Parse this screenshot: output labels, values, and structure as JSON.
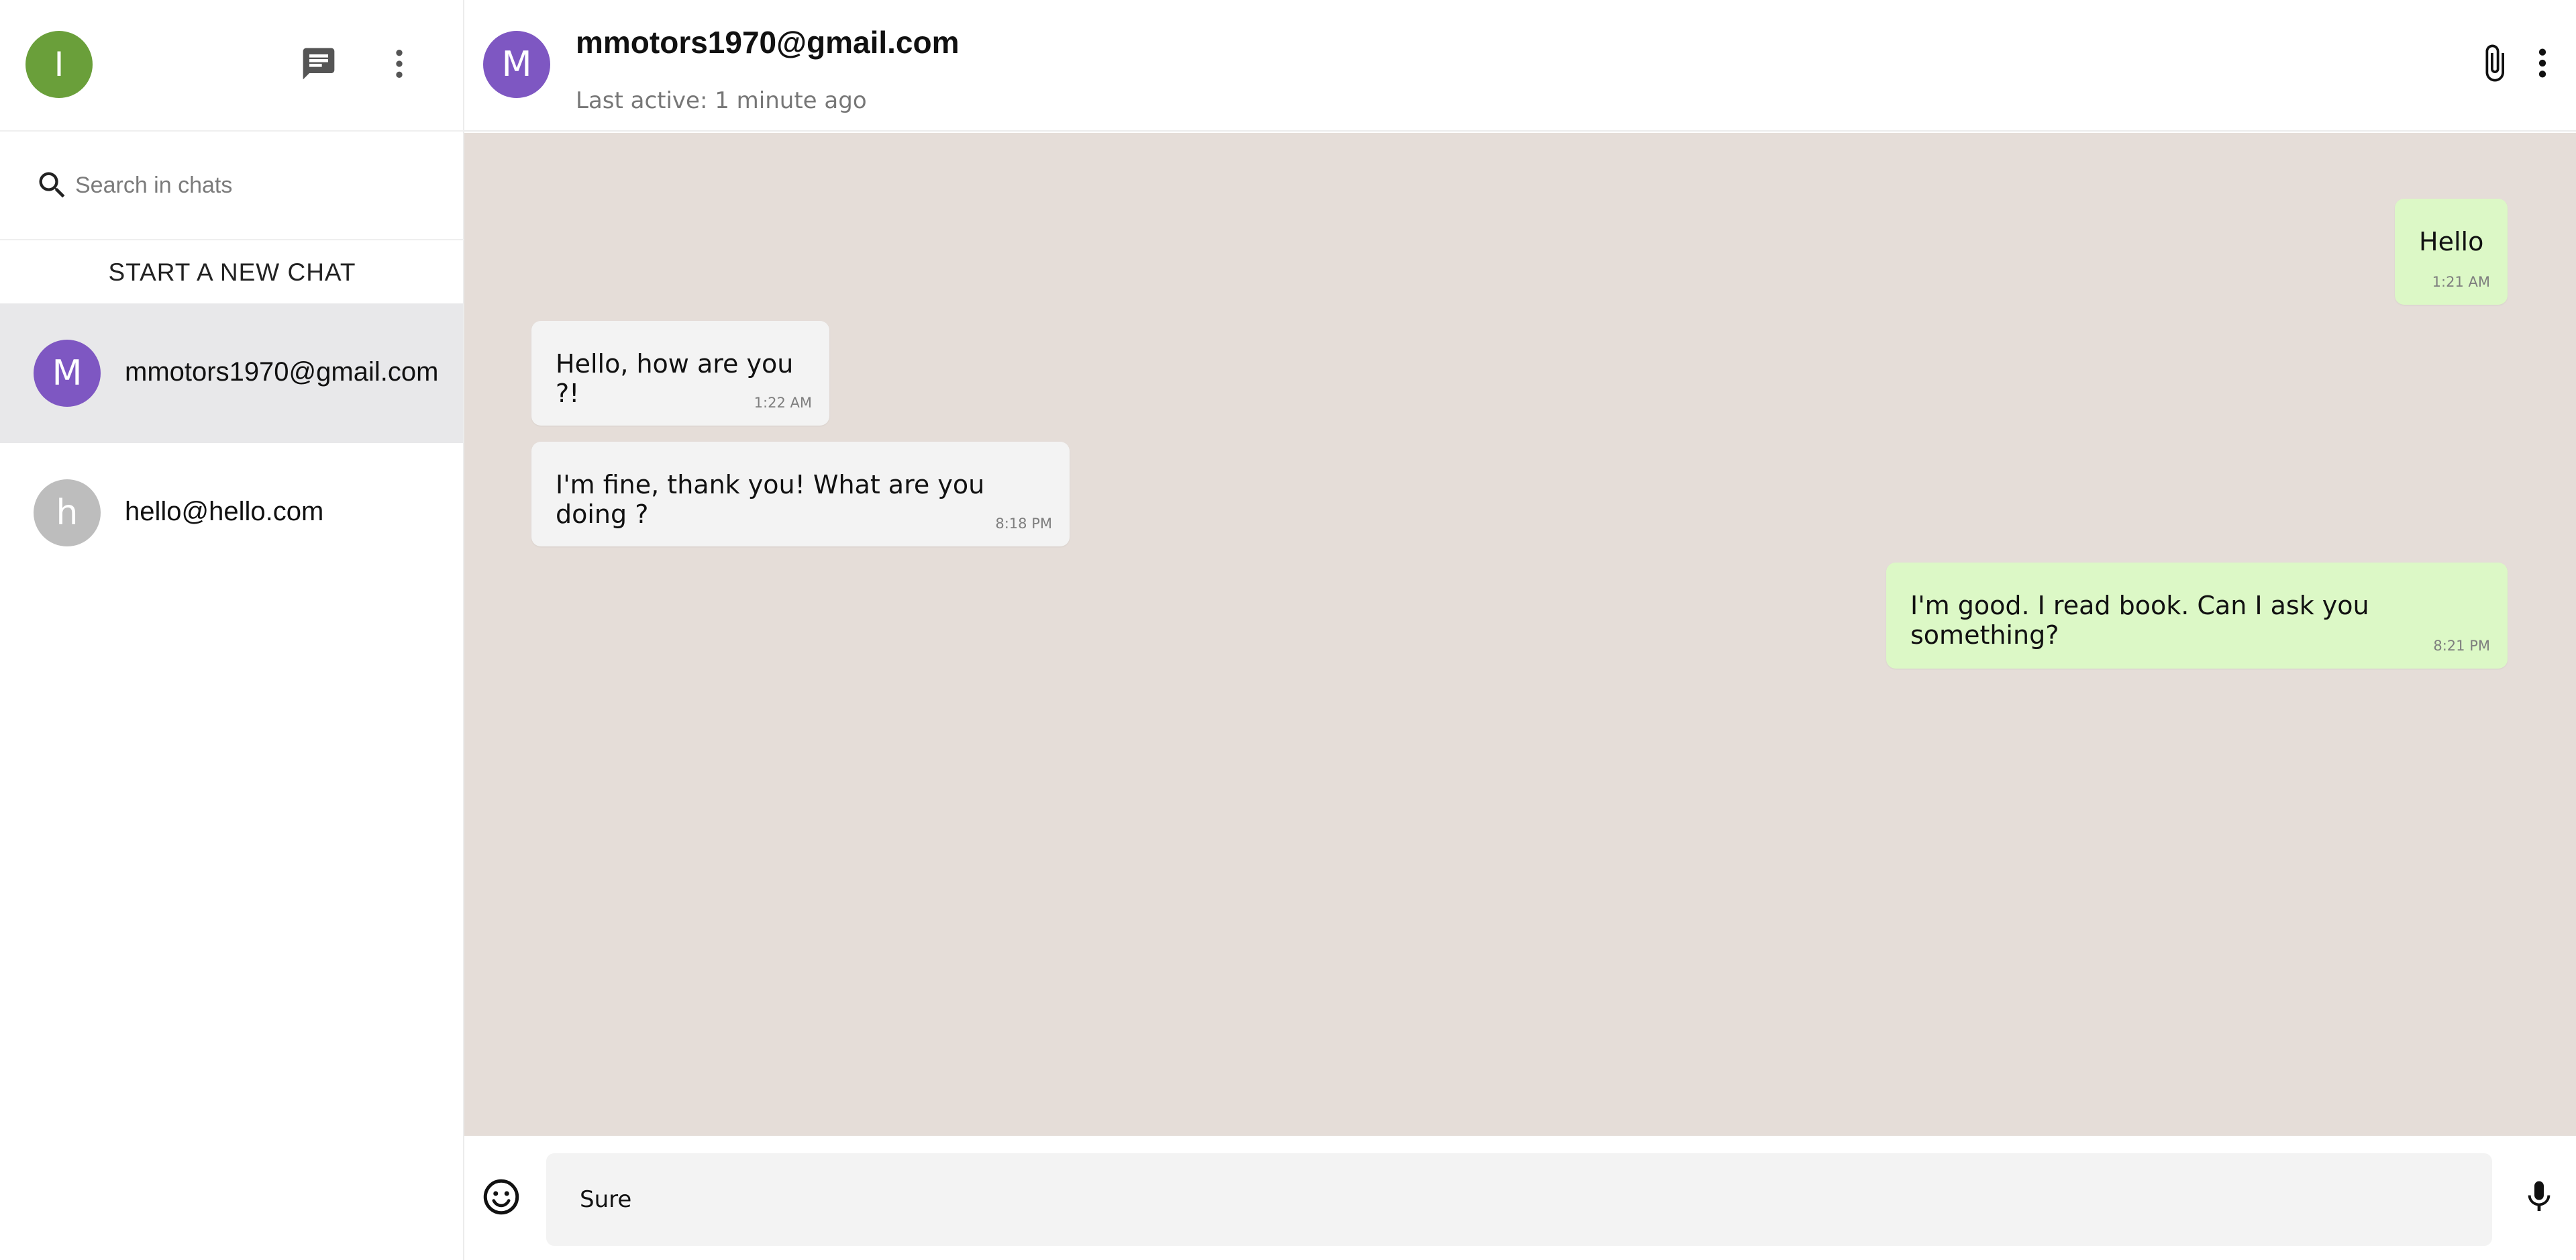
{
  "sidebar": {
    "user_avatar_letter": "I",
    "icons": {
      "chat": "chat-icon",
      "menu": "more-vert-icon",
      "search": "search-icon"
    },
    "search_placeholder": "Search in chats",
    "new_chat_label": "START A NEW CHAT",
    "chats": [
      {
        "avatar_letter": "M",
        "name": "mmotors1970@gmail.com",
        "active": true,
        "avatar_color": "#7e57c2"
      },
      {
        "avatar_letter": "h",
        "name": "hello@hello.com",
        "active": false,
        "avatar_color": "#bdbdbd"
      }
    ]
  },
  "header": {
    "avatar_letter": "M",
    "contact_name": "mmotors1970@gmail.com",
    "last_active": "Last active: 1 minute ago",
    "icons": {
      "attach": "paperclip-icon",
      "menu": "more-vert-icon"
    }
  },
  "messages": [
    {
      "direction": "out",
      "text": "Hello",
      "time": "1:21 AM"
    },
    {
      "direction": "in",
      "text": "Hello, how are you ?!",
      "time": "1:22 AM"
    },
    {
      "direction": "in",
      "text": "I'm fine, thank you! What are you doing ?",
      "time": "8:18 PM"
    },
    {
      "direction": "out",
      "text": "I'm good. I read book. Can I ask you something?",
      "time": "8:21 PM"
    }
  ],
  "composer": {
    "value": "Sure",
    "icons": {
      "emoji": "emoji-icon",
      "mic": "microphone-icon"
    }
  },
  "colors": {
    "user_avatar": "#6a9f3a",
    "contact_avatar": "#7e57c2",
    "chat_background": "#e5ddd8",
    "incoming_bubble": "#f3f3f3",
    "outgoing_bubble": "#dcf8c6",
    "active_chat": "#e8e8ea"
  }
}
